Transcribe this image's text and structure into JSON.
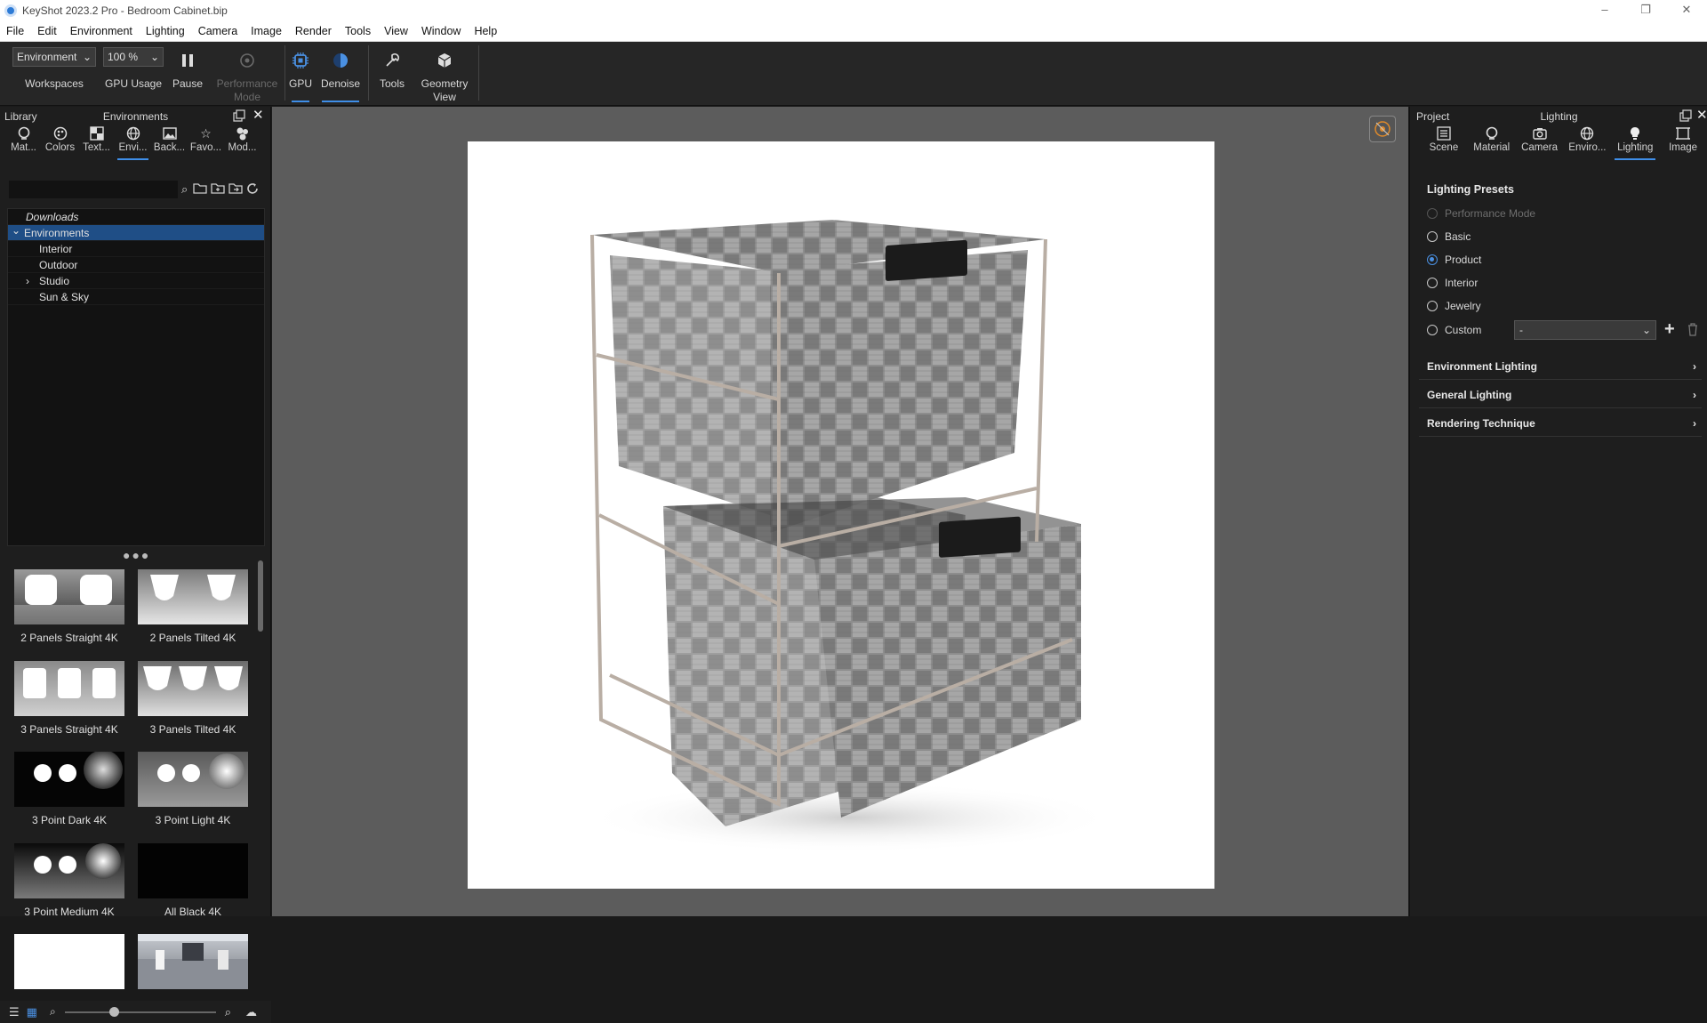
{
  "window": {
    "title": "KeyShot 2023.2 Pro  - Bedroom Cabinet.bip",
    "controls": [
      "–",
      "❐",
      "✕"
    ]
  },
  "menu": [
    "File",
    "Edit",
    "Environment",
    "Lighting",
    "Camera",
    "Image",
    "Render",
    "Tools",
    "View",
    "Window",
    "Help"
  ],
  "toolbar": {
    "workspace_select": "Environment",
    "zoom_select": "100 %",
    "workspaces_label": "Workspaces",
    "gpu_usage_label": "GPU Usage",
    "pause_label": "Pause",
    "performance_mode_label": "Performance Mode",
    "gpu_label": "GPU",
    "denoise_label": "Denoise",
    "tools_label": "Tools",
    "geometry_view_label": "Geometry View"
  },
  "library": {
    "header_left": "Library",
    "header_title": "Environments",
    "tabs": [
      "Mat...",
      "Colors",
      "Text...",
      "Envi...",
      "Back...",
      "Favo...",
      "Mod..."
    ],
    "active_tab_index": 3,
    "search_placeholder": "",
    "tree": [
      {
        "label": "Downloads",
        "italic": true,
        "indent": 0,
        "selected": false,
        "expander": ""
      },
      {
        "label": "Environments",
        "italic": false,
        "indent": 0,
        "selected": true,
        "expander": "⌄"
      },
      {
        "label": "Interior",
        "italic": false,
        "indent": 1,
        "selected": false,
        "expander": ""
      },
      {
        "label": "Outdoor",
        "italic": false,
        "indent": 1,
        "selected": false,
        "expander": ""
      },
      {
        "label": "Studio",
        "italic": false,
        "indent": 1,
        "selected": false,
        "expander": "›"
      },
      {
        "label": "Sun & Sky",
        "italic": false,
        "indent": 1,
        "selected": false,
        "expander": ""
      }
    ],
    "dots": "●●●",
    "thumbnails": [
      {
        "label": "2 Panels Straight 4K",
        "style": "panels2s"
      },
      {
        "label": "2 Panels Tilted 4K",
        "style": "panels2t"
      },
      {
        "label": "3 Panels Straight 4K",
        "style": "panels3s"
      },
      {
        "label": "3 Panels Tilted 4K",
        "style": "panels3t"
      },
      {
        "label": "3 Point Dark 4K",
        "style": "point3d"
      },
      {
        "label": "3 Point Light 4K",
        "style": "point3l"
      },
      {
        "label": "3 Point Medium 4K",
        "style": "point3m"
      },
      {
        "label": "All Black 4K",
        "style": "black"
      },
      {
        "label": "",
        "style": "white"
      },
      {
        "label": "",
        "style": "room"
      }
    ]
  },
  "project": {
    "header_left": "Project",
    "header_title": "Lighting",
    "tabs": [
      "Scene",
      "Material",
      "Camera",
      "Enviro...",
      "Lighting",
      "Image"
    ],
    "active_tab_index": 4,
    "presets_title": "Lighting Presets",
    "presets": [
      {
        "label": "Performance Mode",
        "checked": false,
        "disabled": true
      },
      {
        "label": "Basic",
        "checked": false,
        "disabled": false
      },
      {
        "label": "Product",
        "checked": true,
        "disabled": false
      },
      {
        "label": "Interior",
        "checked": false,
        "disabled": false
      },
      {
        "label": "Jewelry",
        "checked": false,
        "disabled": false
      },
      {
        "label": "Custom",
        "checked": false,
        "disabled": false
      }
    ],
    "custom_select": "-",
    "sections": [
      "Environment Lighting",
      "General Lighting",
      "Rendering Technique"
    ]
  },
  "colors": {
    "accent": "#3f8ee8",
    "selection": "#1f4e86",
    "viewport_bg": "#5c5c5c",
    "panel_bg": "#1e1e1e"
  }
}
